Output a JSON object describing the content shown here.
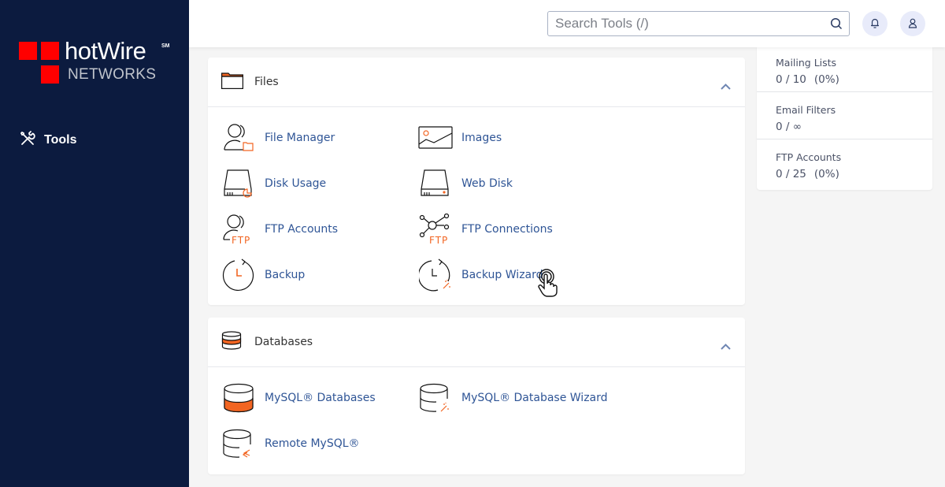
{
  "sidebar": {
    "logo": {
      "brand": "hotWire",
      "mark": "SM",
      "sub": "NETWORKS",
      "color": "#ff0000"
    },
    "nav": [
      {
        "label": "Tools",
        "icon": "tools-icon"
      }
    ],
    "background": "#0c1b3f"
  },
  "topbar": {
    "search": {
      "placeholder": "Search Tools (/)",
      "value": ""
    },
    "notifications_icon": "bell-icon",
    "user_icon": "user-icon"
  },
  "sections": [
    {
      "title": "Files",
      "icon": "folder-icon",
      "expanded": true,
      "items": [
        {
          "label": "File Manager",
          "icon": "file-manager-icon"
        },
        {
          "label": "Images",
          "icon": "images-icon"
        },
        {
          "label": "Disk Usage",
          "icon": "disk-usage-icon"
        },
        {
          "label": "Web Disk",
          "icon": "web-disk-icon"
        },
        {
          "label": "FTP Accounts",
          "icon": "ftp-accounts-icon"
        },
        {
          "label": "FTP Connections",
          "icon": "ftp-connections-icon"
        },
        {
          "label": "Backup",
          "icon": "backup-icon"
        },
        {
          "label": "Backup Wizard",
          "icon": "backup-wizard-icon"
        }
      ]
    },
    {
      "title": "Databases",
      "icon": "database-icon",
      "expanded": true,
      "items": [
        {
          "label": "MySQL® Databases",
          "icon": "mysql-databases-icon"
        },
        {
          "label": "MySQL® Database Wizard",
          "icon": "mysql-wizard-icon"
        },
        {
          "label": "Remote MySQL®",
          "icon": "remote-mysql-icon"
        }
      ]
    }
  ],
  "stats": [
    {
      "label": "Mailing Lists",
      "value": "0 / 10",
      "percent": "(0%)"
    },
    {
      "label": "Email Filters",
      "value": "0 / ∞",
      "percent": ""
    },
    {
      "label": "FTP Accounts",
      "value": "0 / 25",
      "percent": "(0%)"
    }
  ],
  "colors": {
    "accent": "#f26522",
    "link": "#2f5596",
    "sidebar": "#0c1b3f"
  }
}
